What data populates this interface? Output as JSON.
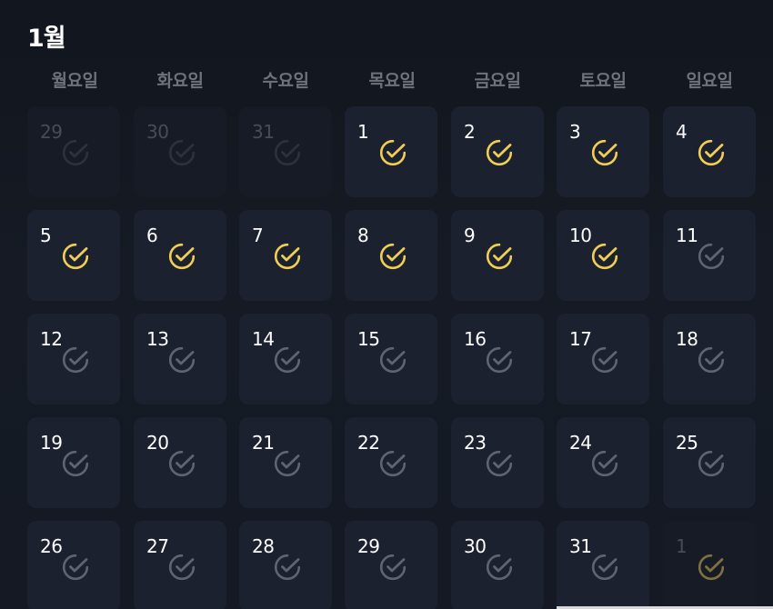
{
  "month_title": "1월",
  "colors": {
    "checked": "#f0ce53",
    "unchecked": "#5f6470",
    "other_month_checked": "#7f7142",
    "other_month_unchecked": "#2c313c"
  },
  "weekdays": [
    "월요일",
    "화요일",
    "수요일",
    "목요일",
    "금요일",
    "토요일",
    "일요일"
  ],
  "weeks": [
    [
      {
        "day": "29",
        "month": "prev",
        "checked": false
      },
      {
        "day": "30",
        "month": "prev",
        "checked": false
      },
      {
        "day": "31",
        "month": "prev",
        "checked": false
      },
      {
        "day": "1",
        "month": "current",
        "checked": true
      },
      {
        "day": "2",
        "month": "current",
        "checked": true
      },
      {
        "day": "3",
        "month": "current",
        "checked": true
      },
      {
        "day": "4",
        "month": "current",
        "checked": true
      }
    ],
    [
      {
        "day": "5",
        "month": "current",
        "checked": true
      },
      {
        "day": "6",
        "month": "current",
        "checked": true
      },
      {
        "day": "7",
        "month": "current",
        "checked": true
      },
      {
        "day": "8",
        "month": "current",
        "checked": true
      },
      {
        "day": "9",
        "month": "current",
        "checked": true
      },
      {
        "day": "10",
        "month": "current",
        "checked": true
      },
      {
        "day": "11",
        "month": "current",
        "checked": false
      }
    ],
    [
      {
        "day": "12",
        "month": "current",
        "checked": false
      },
      {
        "day": "13",
        "month": "current",
        "checked": false
      },
      {
        "day": "14",
        "month": "current",
        "checked": false
      },
      {
        "day": "15",
        "month": "current",
        "checked": false
      },
      {
        "day": "16",
        "month": "current",
        "checked": false
      },
      {
        "day": "17",
        "month": "current",
        "checked": false
      },
      {
        "day": "18",
        "month": "current",
        "checked": false
      }
    ],
    [
      {
        "day": "19",
        "month": "current",
        "checked": false
      },
      {
        "day": "20",
        "month": "current",
        "checked": false
      },
      {
        "day": "21",
        "month": "current",
        "checked": false
      },
      {
        "day": "22",
        "month": "current",
        "checked": false
      },
      {
        "day": "23",
        "month": "current",
        "checked": false
      },
      {
        "day": "24",
        "month": "current",
        "checked": false
      },
      {
        "day": "25",
        "month": "current",
        "checked": false
      }
    ],
    [
      {
        "day": "26",
        "month": "current",
        "checked": false
      },
      {
        "day": "27",
        "month": "current",
        "checked": false
      },
      {
        "day": "28",
        "month": "current",
        "checked": false
      },
      {
        "day": "29",
        "month": "current",
        "checked": false
      },
      {
        "day": "30",
        "month": "current",
        "checked": false
      },
      {
        "day": "31",
        "month": "current",
        "checked": false
      },
      {
        "day": "1",
        "month": "next",
        "checked": true
      }
    ]
  ]
}
